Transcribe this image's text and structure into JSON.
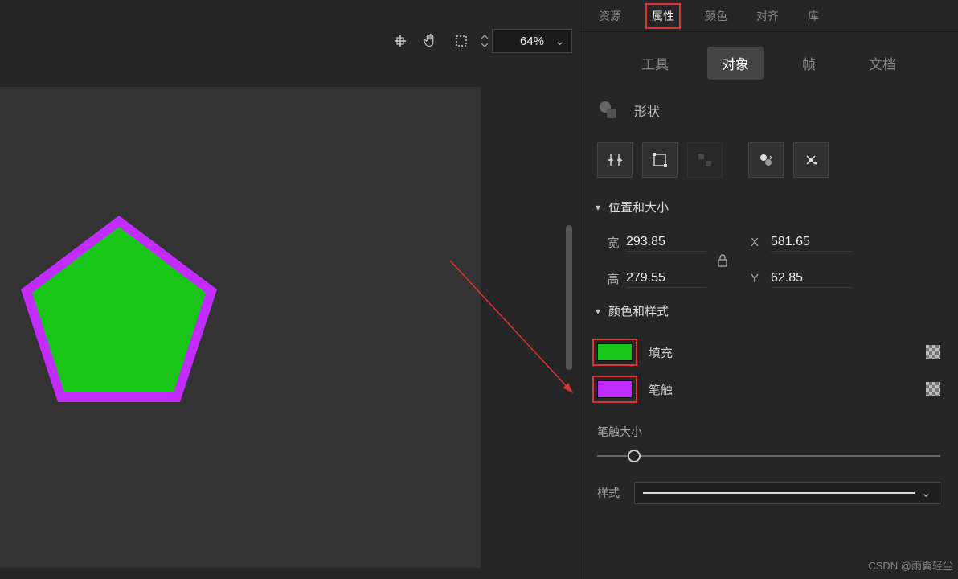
{
  "zoom": {
    "value": "64%"
  },
  "panel": {
    "top_tabs": {
      "resources": "资源",
      "properties": "属性",
      "colors": "颜色",
      "align": "对齐",
      "library": "库"
    },
    "sub_tabs": {
      "tool": "工具",
      "object": "对象",
      "frame": "帧",
      "document": "文档"
    },
    "shape": {
      "label": "形状"
    },
    "position": {
      "title": "位置和大小",
      "w_label": "宽",
      "w_value": "293.85",
      "h_label": "高",
      "h_value": "279.55",
      "x_label": "X",
      "x_value": "581.65",
      "y_label": "Y",
      "y_value": "62.85"
    },
    "color_style": {
      "title": "颜色和样式",
      "fill_label": "填充",
      "stroke_label": "笔触",
      "fill_color": "#17c617",
      "stroke_color": "#c22cff"
    },
    "stroke_size": {
      "label": "笔触大小"
    },
    "style_row": {
      "label": "样式"
    }
  },
  "watermark": "CSDN @雨翼轻尘"
}
